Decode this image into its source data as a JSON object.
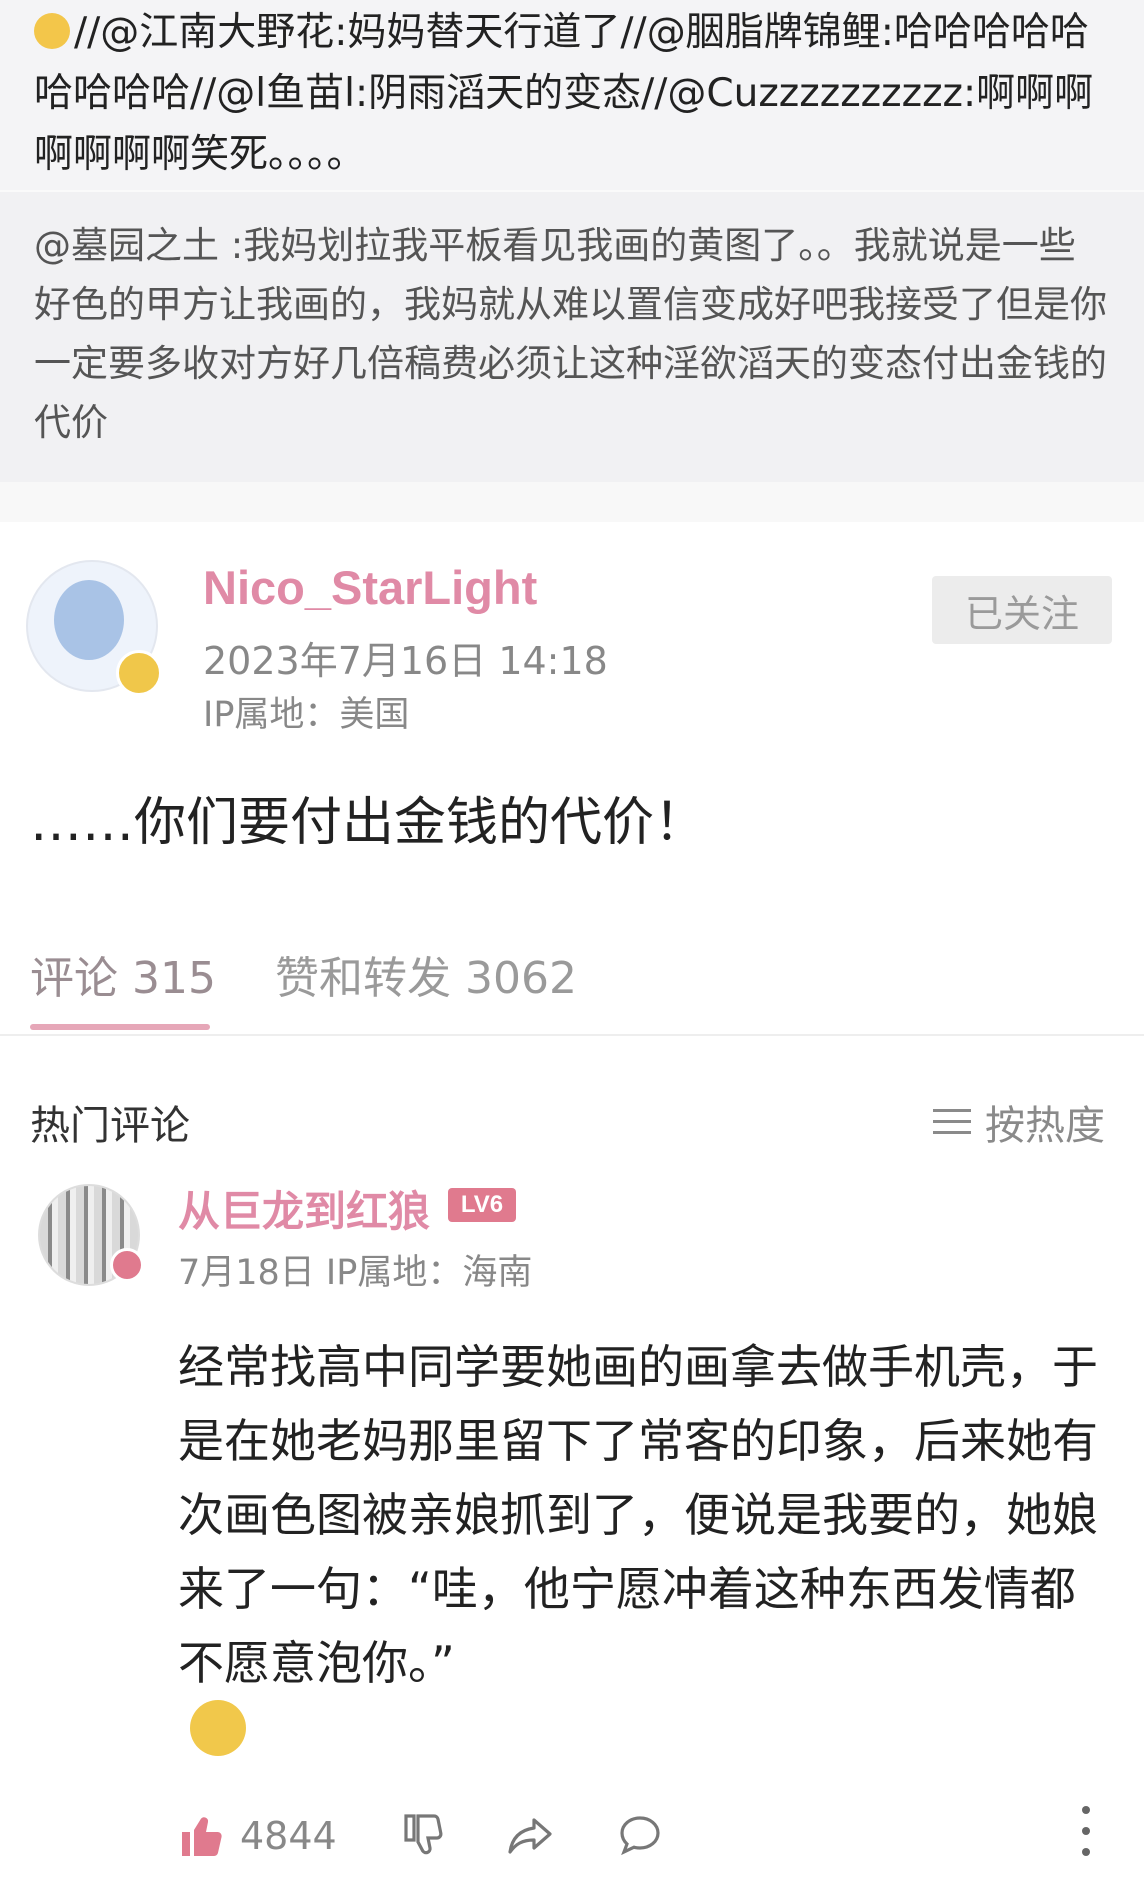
{
  "repost_chain": {
    "text": "//@江南大野花:妈妈替天行道了//@胭脂牌锦鲤:哈哈哈哈哈哈哈哈哈//@l鱼苗l:阴雨滔天的变态//@Cuzzzzzzzzzz:啊啊啊啊啊啊啊笑死。。。。"
  },
  "quoted_post": {
    "text": "@墓园之土 :我妈划拉我平板看见我画的黄图了。。我就说是一些好色的甲方让我画的，我妈就从难以置信变成好吧我接受了但是你一定要多收对方好几倍稿费必须让这种淫欲滔天的变态付出金钱的代价"
  },
  "post": {
    "username": "Nico_StarLight",
    "timestamp": "2023年7月16日 14:18",
    "ip_location": "IP属地：美国",
    "follow_label": "已关注",
    "text": "……你们要付出金钱的代价！"
  },
  "tabs": {
    "comments": "评论 315",
    "likes_reposts": "赞和转发 3062"
  },
  "comments_header": {
    "title": "热门评论",
    "sort_label": "按热度"
  },
  "comment": {
    "username": "从巨龙到红狼",
    "level_badge": "LV6",
    "meta": "7月18日  IP属地：海南",
    "text": "经常找高中同学要她画的画拿去做手机壳，于是在她老妈那里留下了常客的印象，后来她有次画色图被亲娘抓到了，便说是我要的，她娘来了一句：“哇，他宁愿冲着这种东西发情都不愿意泡你。”",
    "like_count": "4844"
  },
  "colors": {
    "username_pink": "#e08aa6",
    "like_red": "#e07a8e",
    "tab_underline": "#e6a7b8"
  },
  "icons": [
    "laugh-emoji-icon",
    "avatar-image",
    "thumbs-up-icon",
    "thumbs-down-icon",
    "share-icon",
    "comment-bubble-icon",
    "more-icon",
    "menu-icon",
    "sneer-emoji-icon"
  ]
}
